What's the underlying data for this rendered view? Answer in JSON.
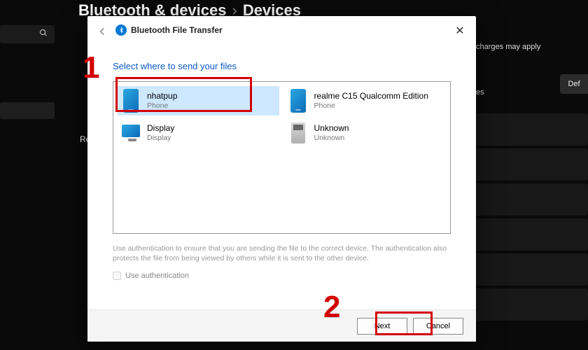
{
  "background": {
    "breadcrumb_parent": "Bluetooth & devices",
    "breadcrumb_sep": "›",
    "breadcrumb_current": "Devices",
    "charges_note": "charges may apply",
    "def_button": "Def",
    "es_label": "es",
    "re_label": "Re"
  },
  "dialog": {
    "title": "Bluetooth File Transfer",
    "instruction": "Select where to send your files",
    "devices": [
      {
        "name": "nhatpup",
        "type": "Phone",
        "icon": "phone",
        "selected": true
      },
      {
        "name": "realme C15 Qualcomm Edition",
        "type": "Phone",
        "icon": "phone",
        "selected": false
      },
      {
        "name": "Display",
        "type": "Display",
        "icon": "display",
        "selected": false
      },
      {
        "name": "Unknown",
        "type": "Unknown",
        "icon": "unknown",
        "selected": false
      }
    ],
    "help_text": "Use authentication to ensure that you are sending the file to the correct device. The authentication also protects the file from being viewed by others while it is sent to the other device.",
    "auth_label": "Use authentication",
    "next_label": "Next",
    "cancel_label": "Cancel"
  },
  "annotations": {
    "one": "1",
    "two": "2"
  }
}
